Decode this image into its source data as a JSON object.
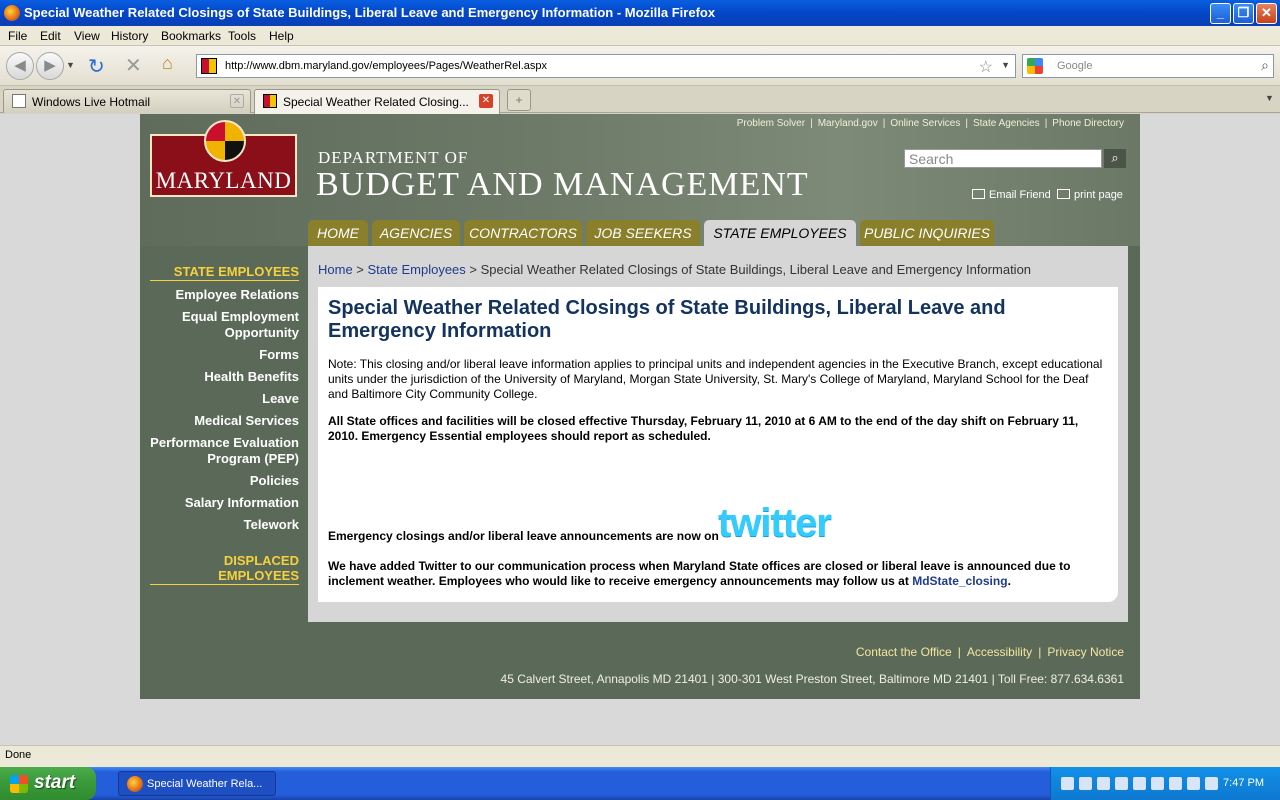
{
  "window": {
    "title": "Special Weather Related Closings of State Buildings, Liberal Leave and Emergency Information - Mozilla Firefox",
    "buttons": {
      "minimize": "_",
      "maximize": "❐",
      "close": "✕"
    }
  },
  "menu": [
    "File",
    "Edit",
    "View",
    "History",
    "Bookmarks",
    "Tools",
    "Help"
  ],
  "nav": {
    "url": "http://www.dbm.maryland.gov/employees/Pages/WeatherRel.aspx",
    "search_placeholder": "Google"
  },
  "tabs": [
    {
      "label": "Windows Live Hotmail",
      "active": false
    },
    {
      "label": "Special Weather Related Closing...",
      "active": true
    }
  ],
  "site": {
    "logo_text": "MARYLAND",
    "dept_of": "DEPARTMENT OF",
    "dept_name": "BUDGET AND MANAGEMENT",
    "top_links": [
      "Problem Solver",
      "Maryland.gov",
      "Online Services",
      "State Agencies",
      "Phone Directory"
    ],
    "search_placeholder": "Search",
    "email_friend": "Email Friend",
    "print_page": "print page",
    "nav_tabs": [
      "HOME",
      "AGENCIES",
      "CONTRACTORS",
      "JOB SEEKERS",
      "STATE EMPLOYEES",
      "PUBLIC INQUIRIES"
    ],
    "sidebar": {
      "heading": "STATE EMPLOYEES",
      "items": [
        "Employee Relations",
        "Equal Employment Opportunity",
        "Forms",
        "Health Benefits",
        "Leave",
        "Medical Services",
        "Performance Evaluation Program (PEP)",
        "Policies",
        "Salary Information",
        "Telework"
      ],
      "heading2": "DISPLACED EMPLOYEES"
    },
    "breadcrumb": {
      "home": "Home",
      "sep": " > ",
      "section": "State Employees",
      "current": "Special Weather Related Closings of State Buildings, Liberal Leave and Emergency Information"
    },
    "content": {
      "title": "Special Weather Related Closings of State Buildings, Liberal Leave and Emergency Information",
      "note": "Note: This closing and/or liberal leave information applies to principal units and independent agencies in the Executive Branch, except educational units under the jurisdiction of the University of Maryland, Morgan State University, St. Mary's College of Maryland, Maryland School for the Deaf and Baltimore City Community College.",
      "closing": "All State offices and facilities will be closed effective Thursday, February 11, 2010 at 6 AM to the end of the day shift on February 11, 2010. Emergency Essential employees should report as scheduled.",
      "twitter_line": "Emergency closings and/or liberal leave announcements are now on",
      "twitter_logo": "twitter",
      "added_text": "We have added Twitter to our communication process when Maryland State offices are closed or liberal leave is announced due to inclement weather. Employees who would like to receive emergency announcements may follow us at",
      "added_link": "MdState_closing",
      "added_end": "."
    },
    "footer": {
      "links": [
        "Contact the Office",
        "Accessibility",
        "Privacy Notice"
      ],
      "address": "45 Calvert Street,  Annapolis MD 21401  | 300-301 West Preston Street,  Baltimore MD 21401  | Toll Free: 877.634.6361"
    }
  },
  "status": "Done",
  "taskbar": {
    "start": "start",
    "task": "Special Weather Rela...",
    "clock": "7:47 PM"
  },
  "colors": {
    "site_bg": "#5b6958",
    "nav_tab": "#8a7f2a",
    "accent_yellow": "#f5d23c",
    "title_blue": "#143460",
    "twitter": "#33ccff"
  }
}
